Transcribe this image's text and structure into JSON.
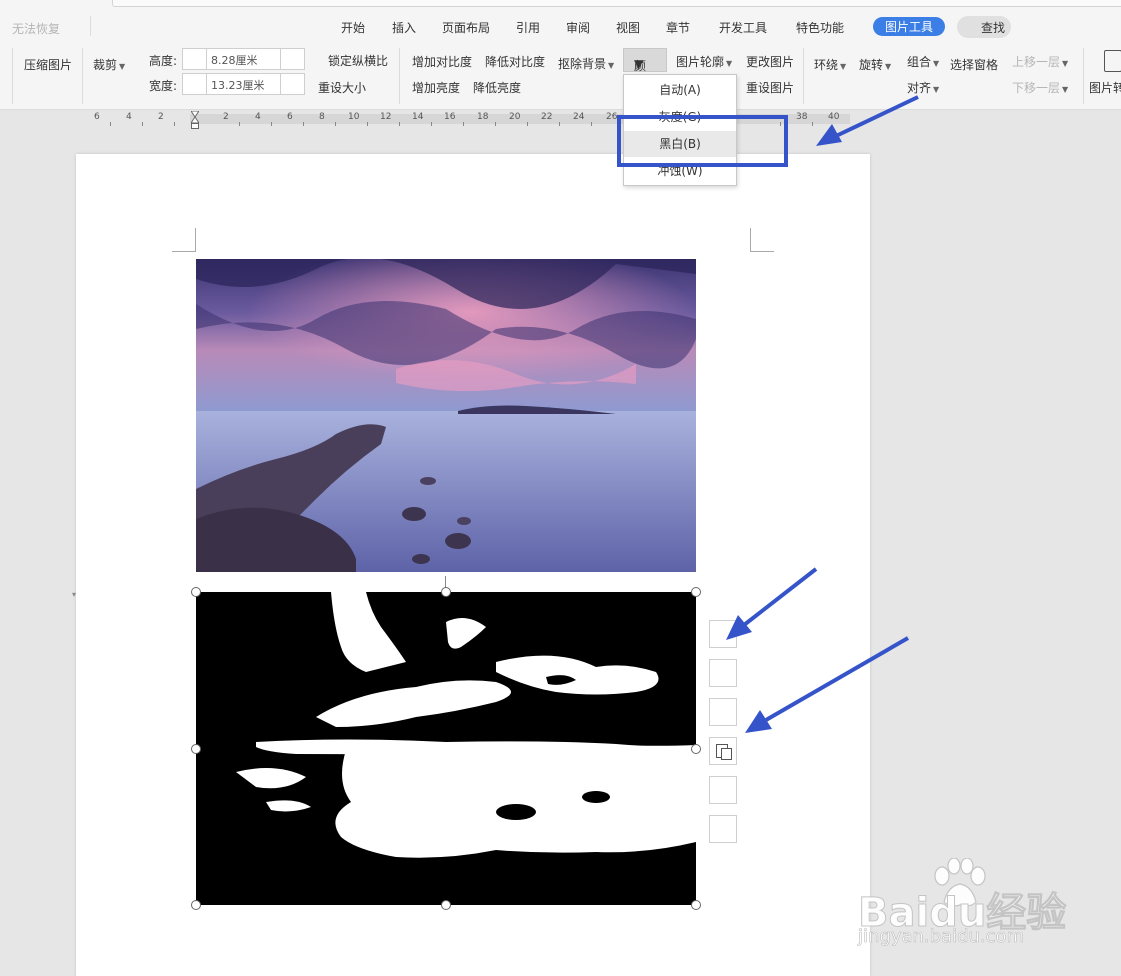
{
  "menubar": {
    "undo_label": "无法恢复",
    "tabs": [
      "开始",
      "插入",
      "页面布局",
      "引用",
      "审阅",
      "视图",
      "章节",
      "开发工具",
      "特色功能"
    ],
    "active_tab": "图片工具",
    "find": "查找"
  },
  "ribbon": {
    "compress": "压缩图片",
    "crop": "裁剪",
    "height_label": "高度:",
    "height_value": "8.28厘米",
    "width_label": "宽度:",
    "width_value": "13.23厘米",
    "lock_ratio": "锁定纵横比",
    "reset_size": "重设大小",
    "increase_contrast": "增加对比度",
    "decrease_contrast": "降低对比度",
    "increase_brightness": "增加亮度",
    "decrease_brightness": "降低亮度",
    "remove_background": "抠除背景",
    "color": "颜色",
    "outline": "图片轮廓",
    "change_picture": "更改图片",
    "reset_picture": "重设图片",
    "wrap": "环绕",
    "rotate": "旋转",
    "group": "组合",
    "align": "对齐",
    "selection_pane": "选择窗格",
    "bring_forward": "上移一层",
    "send_backward": "下移一层",
    "picture_convert": "图片转"
  },
  "ruler": {
    "labels": [
      "6",
      "4",
      "2",
      "2",
      "4",
      "6",
      "8",
      "10",
      "12",
      "14",
      "16",
      "18",
      "20",
      "22",
      "24",
      "26",
      "38",
      "40"
    ]
  },
  "color_menu": {
    "items": [
      "自动(A)",
      "灰度(G)",
      "黑白(B)",
      "冲蚀(W)"
    ],
    "hovered": "黑白(B)"
  },
  "watermark": {
    "brand": "Baidu经验",
    "url": "jingyan.baidu.com"
  },
  "colors": {
    "accent": "#3b7fe6",
    "annotation": "#3554c9",
    "toolbar_bg": "#f5f5f5",
    "workspace_bg": "#e6e6e6"
  }
}
